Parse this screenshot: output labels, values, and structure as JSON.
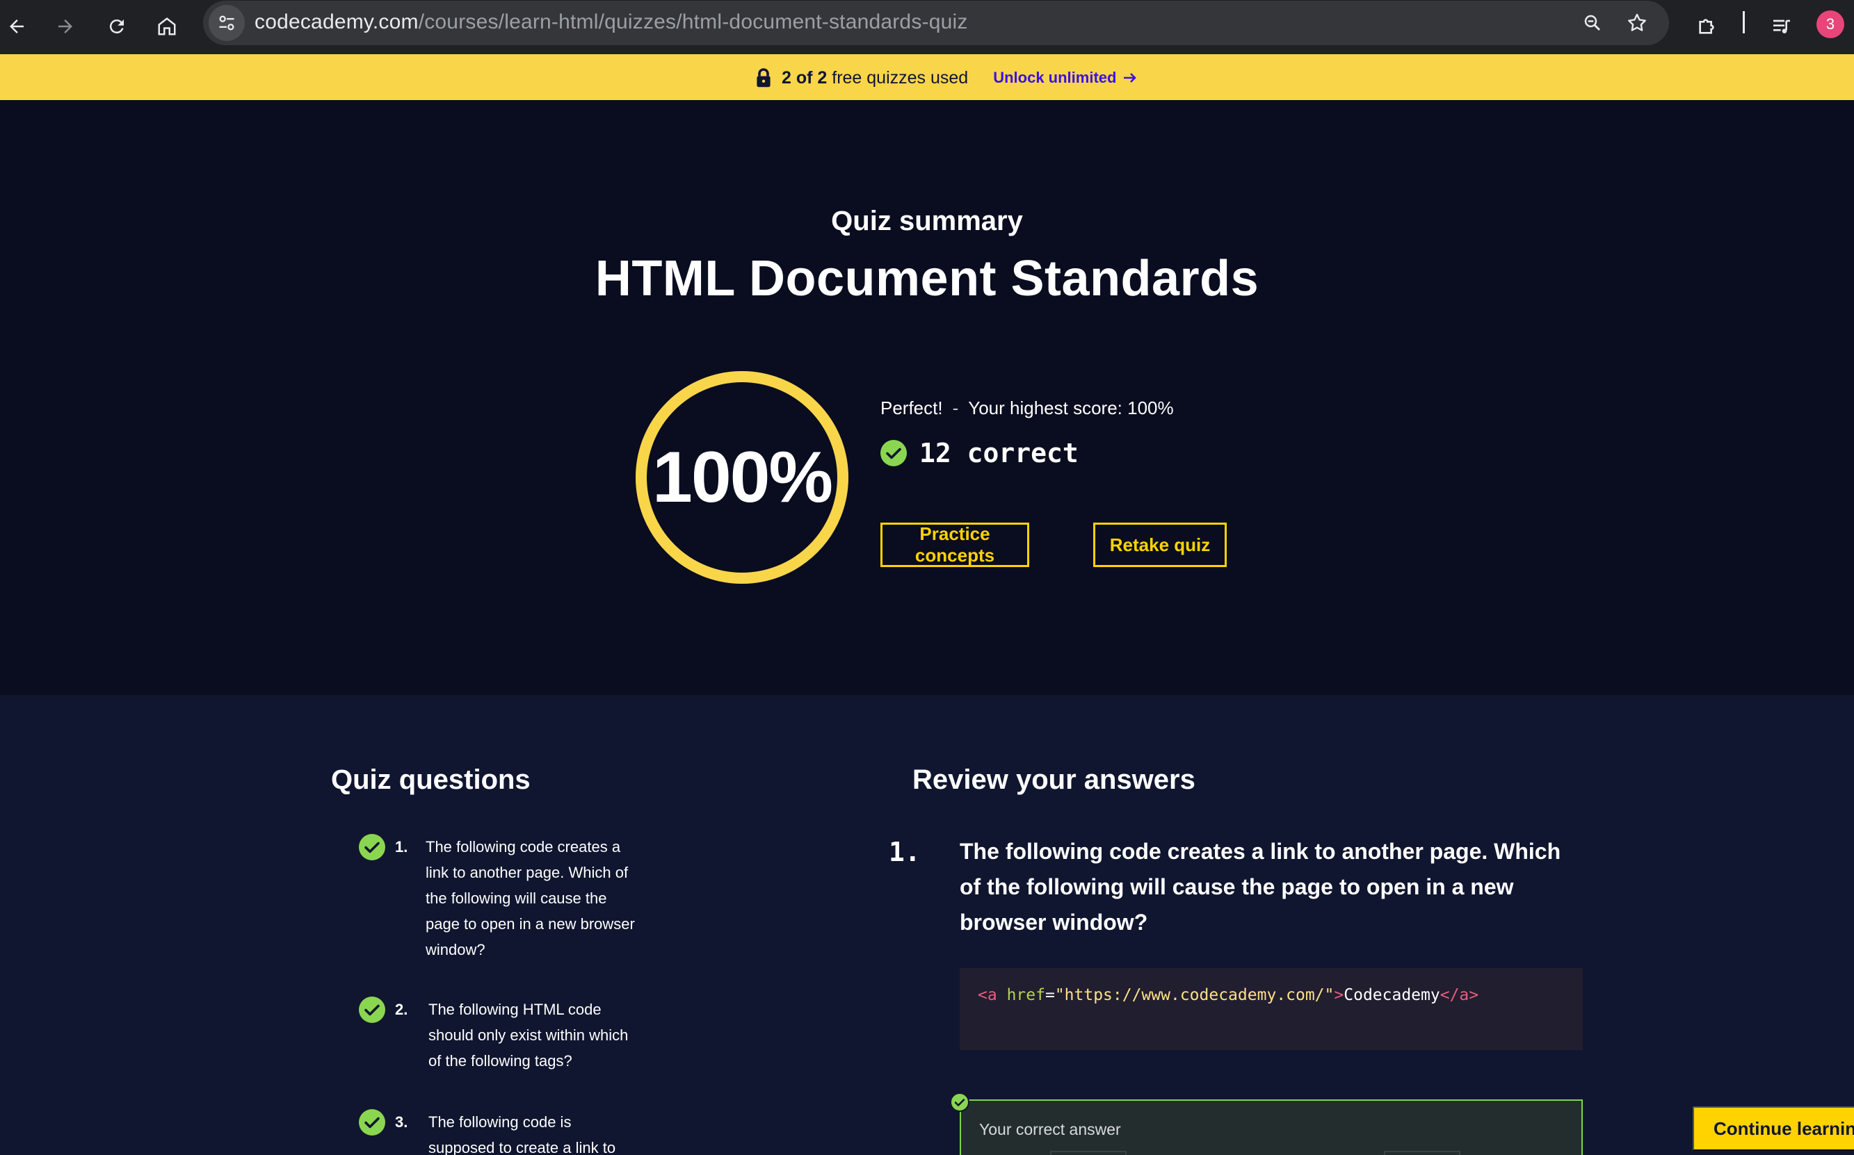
{
  "browser": {
    "url_host": "codecademy.com",
    "url_path": "/courses/learn-html/quizzes/html-document-standards-quiz",
    "profile_initial": "3"
  },
  "banner": {
    "count": "2 of 2",
    "text": "free quizzes used",
    "unlock_label": "Unlock unlimited"
  },
  "summary": {
    "eyebrow": "Quiz summary",
    "title": "HTML Document Standards",
    "score_percent": "100%",
    "score_value": 1.0,
    "verdict": "Perfect!",
    "separator": "-",
    "highest_score": "Your highest score: 100%",
    "correct_count": "12 correct",
    "practice_label": "Practice concepts",
    "retake_label": "Retake quiz"
  },
  "questions": {
    "heading": "Quiz questions",
    "items": [
      {
        "num": "1.",
        "text": "The following code creates a link to another page. Which of the following will cause the page to open in a new browser window?"
      },
      {
        "num": "2.",
        "text": "The following HTML code should only exist within which of the following tags?"
      },
      {
        "num": "3.",
        "text": "The following code is supposed to create a link to"
      }
    ]
  },
  "review": {
    "heading": "Review your answers",
    "num": "1.",
    "question": "The following code creates a link to another page. Which of the following will cause the page to open in a new browser window?",
    "code": {
      "open_tag": "<a",
      "attr": "href",
      "eq": "=",
      "value": "\"https://www.codecademy.com/\"",
      "close_bracket": ">",
      "text": "Codecademy",
      "end_tag": "</a>"
    },
    "answer_label": "Your correct answer"
  },
  "continue_label": "Continue learning",
  "colors": {
    "accent": "#ffd300",
    "banner": "#f9d54a",
    "success": "#8bd650",
    "dark_bg": "#0a0d1f",
    "navy_bg": "#10162f"
  }
}
